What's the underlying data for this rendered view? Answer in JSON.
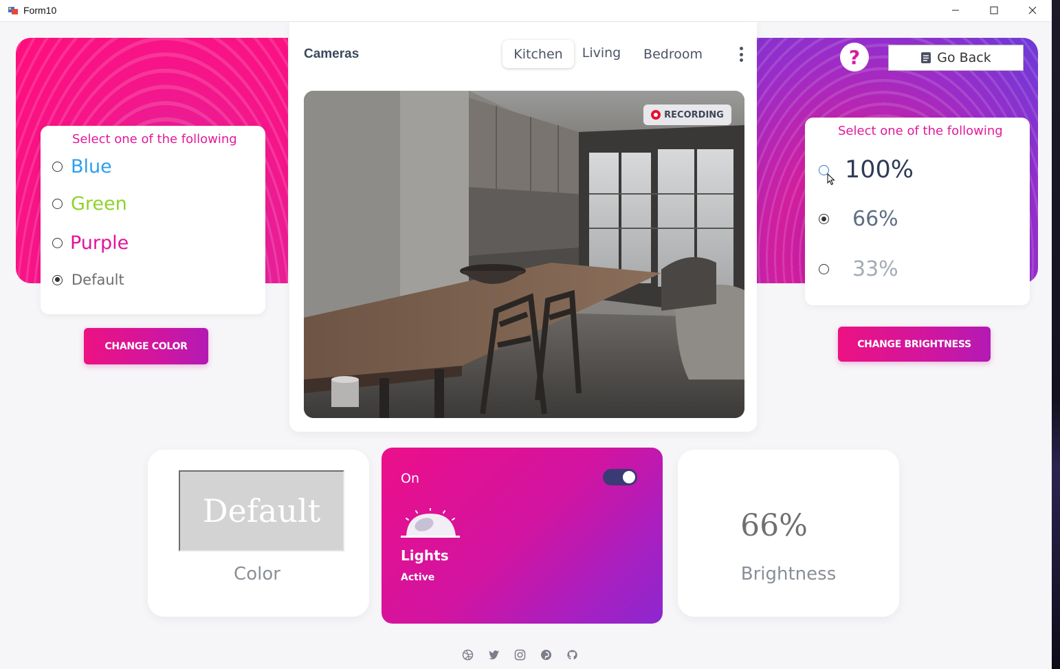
{
  "window": {
    "title": "Form10"
  },
  "left_panel": {
    "heading": "Select one of the following",
    "options": [
      {
        "label": "Blue",
        "color": "#2e9ef0",
        "checked": false
      },
      {
        "label": "Green",
        "color": "#8fd22a",
        "checked": false
      },
      {
        "label": "Purple",
        "color": "#e3119a",
        "checked": false
      },
      {
        "label": "Default",
        "color": "#6d6d6d",
        "checked": true
      }
    ],
    "button_label": "CHANGE COLOR"
  },
  "right_panel": {
    "heading": "Select one of the following",
    "options": [
      {
        "label": "100%",
        "color": "#2f3b56",
        "checked": false
      },
      {
        "label": "66%",
        "color": "#5f6f82",
        "checked": true
      },
      {
        "label": "33%",
        "color": "#a3abb6",
        "checked": false
      }
    ],
    "button_label": "CHANGE BRIGHTNESS",
    "help_label": "?",
    "go_back_label": "Go Back"
  },
  "cameras": {
    "title": "Cameras",
    "tabs": [
      {
        "label": "Kitchen",
        "active": true
      },
      {
        "label": "Living",
        "active": false
      },
      {
        "label": "Bedroom",
        "active": false
      }
    ],
    "recording_label": "RECORDING"
  },
  "color_card": {
    "swatch_text": "Default",
    "caption": "Color"
  },
  "lights_card": {
    "state_label": "On",
    "toggle_on": true,
    "title": "Lights",
    "status": "Active"
  },
  "brightness_card": {
    "value": "66%",
    "caption": "Brightness"
  },
  "footer": {
    "icons": [
      "dribbble-icon",
      "twitter-icon",
      "instagram-icon",
      "pinterest-icon",
      "github-icon"
    ]
  },
  "theme": {
    "accent": "#e3119a",
    "accent_purple": "#9b2cc8"
  }
}
